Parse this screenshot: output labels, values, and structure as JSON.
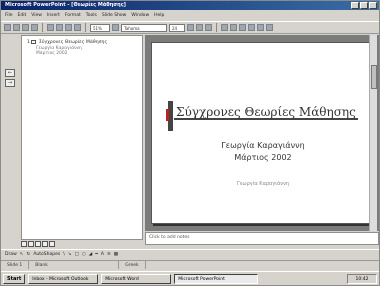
{
  "window": {
    "title": "Microsoft PowerPoint - [Θεωρίες Μάθησης]"
  },
  "menu": [
    "File",
    "Edit",
    "View",
    "Insert",
    "Format",
    "Tools",
    "Slide Show",
    "Window",
    "Help"
  ],
  "toolbar": {
    "zoom": "51%",
    "font": "Tahoma",
    "font_size": "24"
  },
  "outline": {
    "slide_number": "1",
    "title": "Σύγχρονες Θεωρίες Μάθησης",
    "line2": "Γεωργία Καραγιάννη",
    "line3": "Μάρτιος 2002"
  },
  "slide": {
    "title": "Σύγχρονες Θεωρίες Μάθησης",
    "author": "Γεωργία Καραγιάννη",
    "date": "Μάρτιος 2002",
    "footer": "Γεωργία Καραγιάννη"
  },
  "notes": {
    "placeholder": "Click to add notes"
  },
  "drawbar": {
    "draw": "Draw",
    "autoshapes": "AutoShapes"
  },
  "status": {
    "slide": "Slide 1",
    "design": "Blank",
    "language": "Greek"
  },
  "taskbar": {
    "start": "Start",
    "tasks": [
      "Inbox - Microsoft Outlook",
      "Microsoft Word",
      "Microsoft PowerPoint"
    ],
    "time": "10:42"
  }
}
